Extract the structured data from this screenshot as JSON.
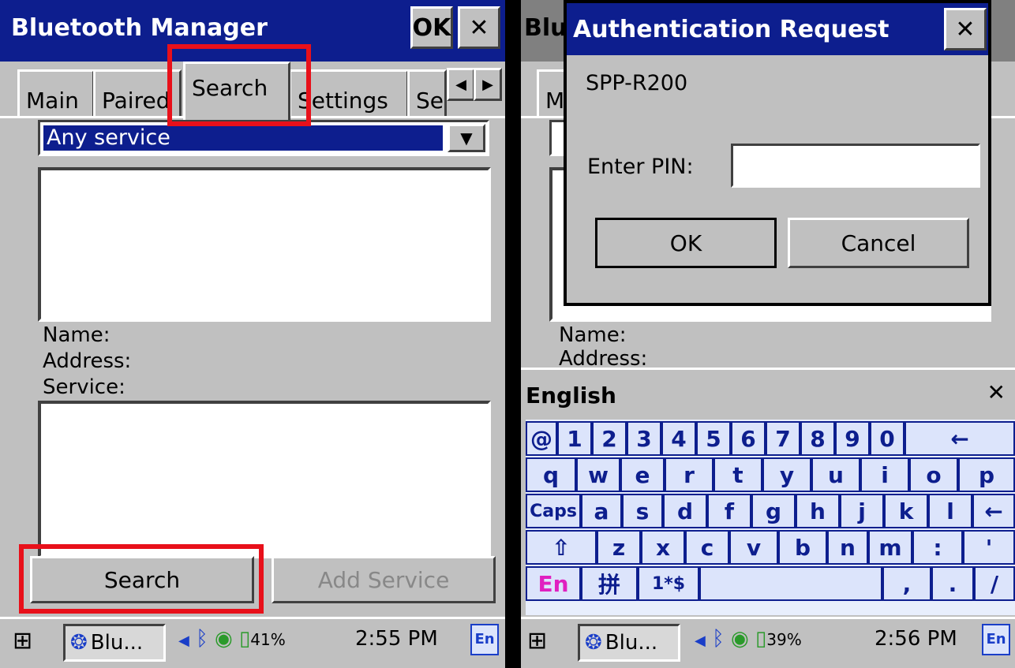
{
  "left": {
    "window_title": "Bluetooth Manager",
    "ok_label": "OK",
    "close_label": "✕",
    "tabs": [
      "Main",
      "Paired",
      "Search",
      "Settings",
      "Se"
    ],
    "service_select": "Any service",
    "labels": {
      "name": "Name:",
      "address": "Address:",
      "service": "Service:"
    },
    "search_button": "Search",
    "add_service_button": "Add Service",
    "taskbar": {
      "app": "Blu...",
      "battery": "41%",
      "time": "2:55 PM",
      "ime": "En"
    }
  },
  "right": {
    "bg_title": "Blu",
    "bg_tab": "Ma",
    "bg_labels": {
      "name": "Name:",
      "address": "Address:"
    },
    "dialog": {
      "title": "Authentication Request",
      "close_label": "✕",
      "device": "SPP-R200",
      "pin_label": "Enter PIN:",
      "pin_value": "",
      "ok_button": "OK",
      "cancel_button": "Cancel"
    },
    "keyboard": {
      "title": "English",
      "close_label": "✕",
      "rows": [
        [
          "@",
          "1",
          "2",
          "3",
          "4",
          "5",
          "6",
          "7",
          "8",
          "9",
          "0",
          "←"
        ],
        [
          "q",
          "w",
          "e",
          "r",
          "t",
          "y",
          "u",
          "i",
          "o",
          "p"
        ],
        [
          "Caps",
          "a",
          "s",
          "d",
          "f",
          "g",
          "h",
          "j",
          "k",
          "l",
          "←"
        ],
        [
          "⇧",
          "z",
          "x",
          "c",
          "v",
          "b",
          "n",
          "m",
          ":",
          "'"
        ],
        [
          "En",
          "拼",
          "1*$",
          "",
          ",",
          ".",
          "/"
        ]
      ]
    },
    "taskbar": {
      "app": "Blu...",
      "battery": "39%",
      "time": "2:56 PM",
      "ime": "En"
    }
  }
}
